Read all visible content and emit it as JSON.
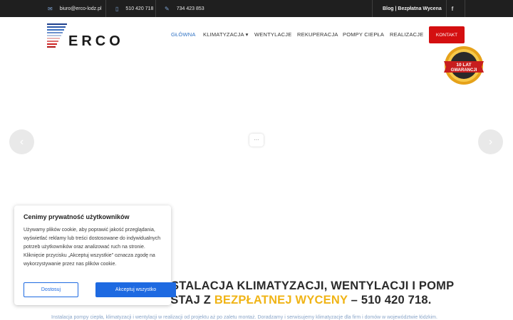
{
  "topbar": {
    "email": "biuro@erco-lodz.pl",
    "phone1": "510 420 718",
    "phone2": "734 423 853",
    "right_links": "Blog | Bezpłatna Wycena",
    "facebook_icon": "facebook-icon",
    "facebook_glyph": "f"
  },
  "logo": {
    "text": "ERCO"
  },
  "nav": {
    "items": [
      "GŁÓWNA",
      "KLIMATYZACJA",
      "WENTYLACJE",
      "REKUPERACJA",
      "POMPY CIEPŁA",
      "REALIZACJE"
    ],
    "dropdown_caret": "▾",
    "contact": "KONTAKT"
  },
  "badge": {
    "line1": "10 LAT",
    "line2": "GWARANCJI"
  },
  "slider": {
    "prev_glyph": "‹",
    "next_glyph": "›",
    "loading_glyph": "⋯"
  },
  "headline": {
    "line1": "STALACJA KLIMATYZACJI, WENTYLACJI I POMP",
    "line2_prefix": "YSTAJ Z ",
    "line2_highlight": "BEZPŁATNEJ WYCENY",
    "line2_suffix": " – 510 420 718."
  },
  "subtext": "Instalacja pompy ciepła, klimatyzacji i wentylacji w realizacji od projektu aż po zaletu montaż. Doradzamy i serwisujemy klimatyzacje dla firm i domów w województwie łódzkim.",
  "cookie": {
    "title": "Cenimy prywatność użytkowników",
    "body": "Używamy plików cookie, aby poprawić jakość przeglądania, wyświetlać reklamy lub treści dostosowane do indywidualnych potrzeb użytkowników oraz analizować ruch na stronie. Kliknięcie przycisku „Akceptuj wszystkie” oznacza zgodę na wykorzystywanie przez nas plików cookie.",
    "customize": "Dostosuj",
    "accept_all": "Akceptuj wszystko"
  },
  "colors": {
    "accent_blue": "#2f72c4",
    "contact_red": "#d40f10",
    "highlight_yellow": "#f0b416",
    "cookie_button_blue": "#1e6ae1"
  }
}
